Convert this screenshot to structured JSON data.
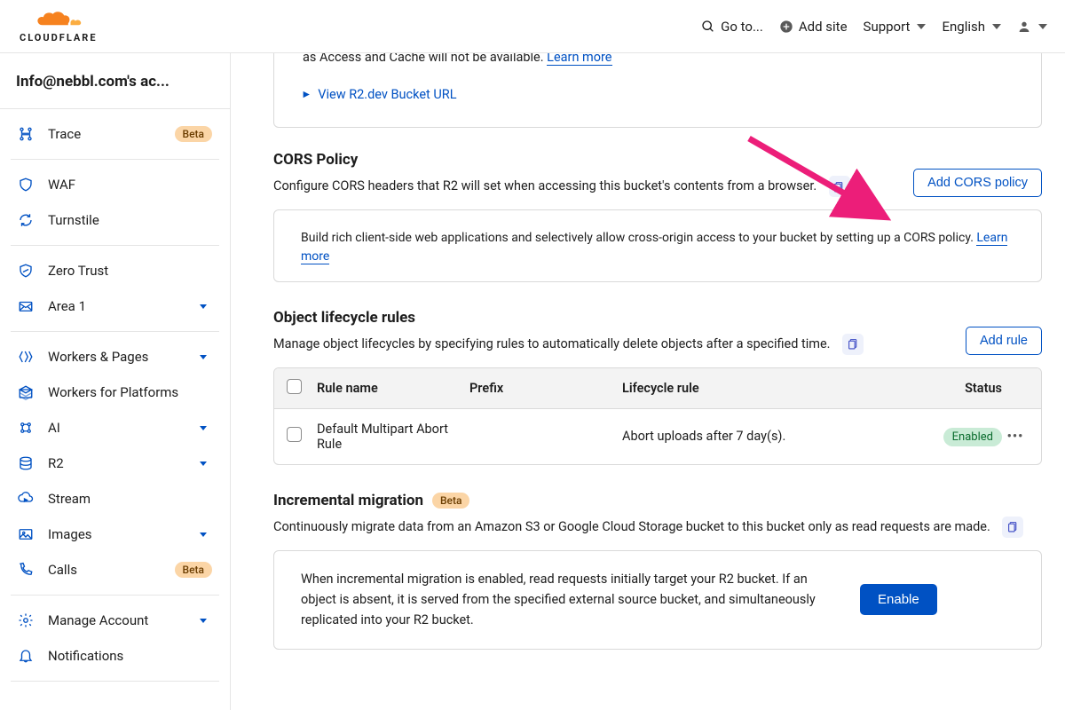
{
  "header": {
    "goto": "Go to...",
    "add_site": "Add site",
    "support": "Support",
    "language": "English",
    "brand": "CLOUDFLARE"
  },
  "sidebar": {
    "account": "Info@nebbl.com's ac...",
    "groups": [
      {
        "items": [
          {
            "icon": "trace",
            "label": "Trace",
            "badge": "Beta"
          }
        ]
      },
      {
        "items": [
          {
            "icon": "waf",
            "label": "WAF"
          },
          {
            "icon": "turnstile",
            "label": "Turnstile"
          }
        ]
      },
      {
        "items": [
          {
            "icon": "zerotrust",
            "label": "Zero Trust"
          },
          {
            "icon": "area1",
            "label": "Area 1",
            "caret": true
          }
        ]
      },
      {
        "items": [
          {
            "icon": "workers",
            "label": "Workers & Pages",
            "caret": true
          },
          {
            "icon": "platforms",
            "label": "Workers for Platforms"
          },
          {
            "icon": "ai",
            "label": "AI",
            "caret": true
          },
          {
            "icon": "r2",
            "label": "R2",
            "caret": true
          },
          {
            "icon": "stream",
            "label": "Stream"
          },
          {
            "icon": "images",
            "label": "Images",
            "caret": true
          },
          {
            "icon": "calls",
            "label": "Calls",
            "badge": "Beta"
          }
        ]
      },
      {
        "items": [
          {
            "icon": "manage",
            "label": "Manage Account",
            "caret": true
          },
          {
            "icon": "notifications",
            "label": "Notifications"
          }
        ]
      }
    ]
  },
  "top_card": {
    "tail_text": "as Access and Cache will not be available. ",
    "learn_more": "Learn more",
    "expand": "View R2.dev Bucket URL"
  },
  "cors": {
    "title": "CORS Policy",
    "desc": "Configure CORS headers that R2 will set when accessing this bucket's contents from a browser.",
    "add_btn": "Add CORS policy",
    "body": "Build rich client-side web applications and selectively allow cross-origin access to your bucket by setting up a CORS policy. ",
    "learn_more": "Learn more"
  },
  "lifecycle": {
    "title": "Object lifecycle rules",
    "desc": "Manage object lifecycles by specifying rules to automatically delete objects after a specified time.",
    "add_btn": "Add rule",
    "cols": {
      "name": "Rule name",
      "prefix": "Prefix",
      "rule": "Lifecycle rule",
      "status": "Status"
    },
    "rows": [
      {
        "name": "Default Multipart Abort Rule",
        "prefix": "",
        "rule": "Abort uploads after 7 day(s).",
        "status": "Enabled"
      }
    ]
  },
  "migration": {
    "title": "Incremental migration",
    "badge": "Beta",
    "desc": "Continuously migrate data from an Amazon S3 or Google Cloud Storage bucket to this bucket only as read requests are made.",
    "body": "When incremental migration is enabled, read requests initially target your R2 bucket. If an object is absent, it is served from the specified external source bucket, and simultaneously replicated into your R2 bucket.",
    "enable_btn": "Enable"
  }
}
